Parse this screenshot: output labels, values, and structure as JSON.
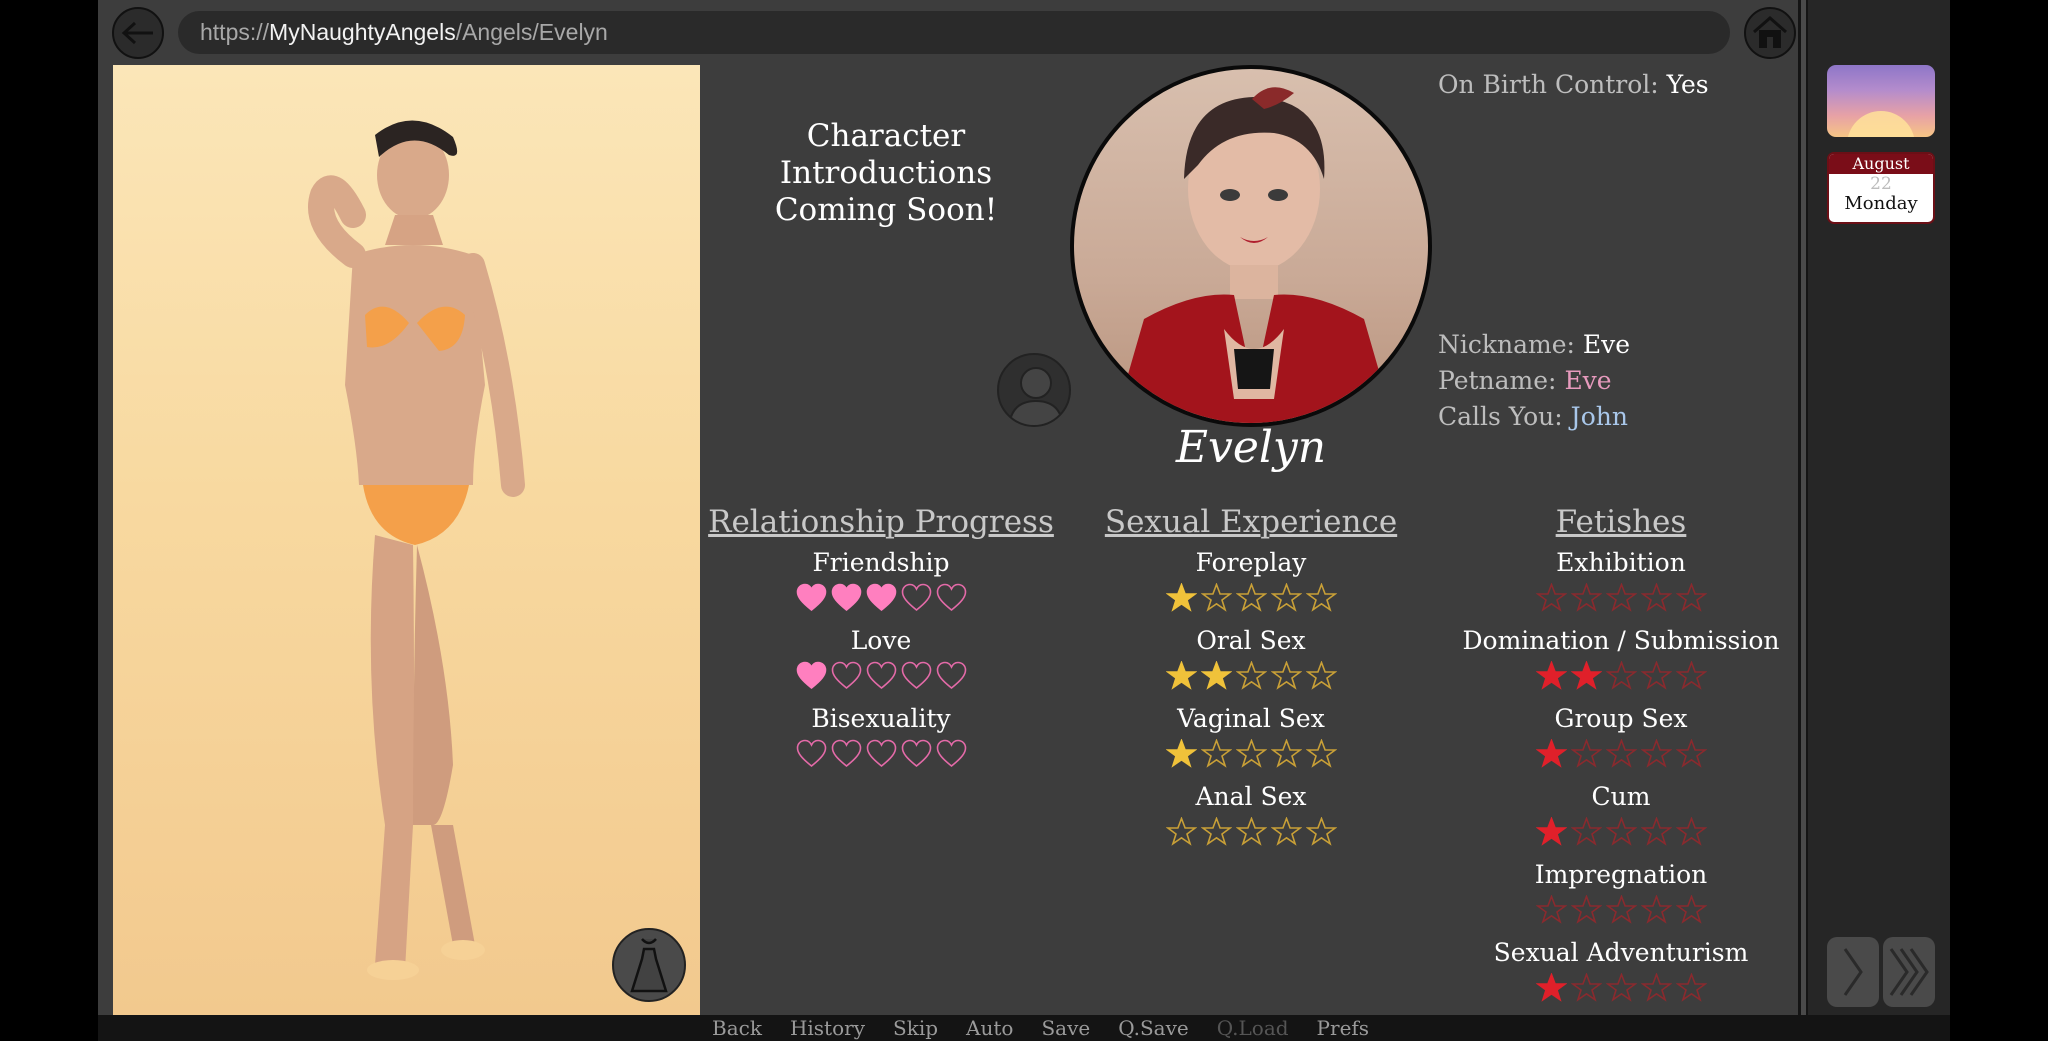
{
  "browser": {
    "url_prefix": "https://",
    "url_host": "MyNaughtyAngels",
    "url_path": "/Angels/Evelyn"
  },
  "intro": {
    "line1": "Character Introductions",
    "line2": "Coming Soon!"
  },
  "character": {
    "name": "Evelyn",
    "birth_control_label": "On Birth Control:",
    "birth_control_value": "Yes",
    "nickname_label": "Nickname:",
    "nickname_value": "Eve",
    "petname_label": "Petname:",
    "petname_value": "Eve",
    "calls_you_label": "Calls You:",
    "calls_you_value": "John"
  },
  "relationship": {
    "title": "Relationship Progress",
    "stats": [
      {
        "label": "Friendship",
        "value": 3,
        "max": 5
      },
      {
        "label": "Love",
        "value": 1,
        "max": 5
      },
      {
        "label": "Bisexuality",
        "value": 0,
        "max": 5
      }
    ]
  },
  "sexual_experience": {
    "title": "Sexual Experience",
    "stats": [
      {
        "label": "Foreplay",
        "value": 1,
        "max": 5
      },
      {
        "label": "Oral Sex",
        "value": 2,
        "max": 5
      },
      {
        "label": "Vaginal Sex",
        "value": 1,
        "max": 5
      },
      {
        "label": "Anal Sex",
        "value": 0,
        "max": 5
      }
    ]
  },
  "fetishes": {
    "title": "Fetishes",
    "stats": [
      {
        "label": "Exhibition",
        "value": 0,
        "max": 5
      },
      {
        "label": "Domination / Submission",
        "value": 2,
        "max": 5
      },
      {
        "label": "Group Sex",
        "value": 1,
        "max": 5
      },
      {
        "label": "Cum",
        "value": 1,
        "max": 5
      },
      {
        "label": "Impregnation",
        "value": 0,
        "max": 5
      },
      {
        "label": "Sexual Adventurism",
        "value": 1,
        "max": 5
      }
    ]
  },
  "calendar": {
    "month": "August",
    "day": "22",
    "weekday": "Monday"
  },
  "menu": {
    "back": "Back",
    "history": "History",
    "skip": "Skip",
    "auto": "Auto",
    "save": "Save",
    "qsave": "Q.Save",
    "qload": "Q.Load",
    "prefs": "Prefs"
  },
  "colors": {
    "heart_fill": "#ff7fbf",
    "heart_outline": "#e46aa8",
    "gold_star": "#f0c23a",
    "gold_outline": "#c9a037",
    "red_star": "#e0202a",
    "red_outline": "#8a2a2e",
    "pink_text": "#e79abd",
    "blue_text": "#a9c7ea"
  },
  "icons": {
    "back": "arrow-left-icon",
    "home": "home-icon",
    "outfit": "dress-icon",
    "silhouette": "person-silhouette-icon",
    "forward": "chevron-right-icon",
    "skip_forward": "double-chevron-right-icon"
  }
}
